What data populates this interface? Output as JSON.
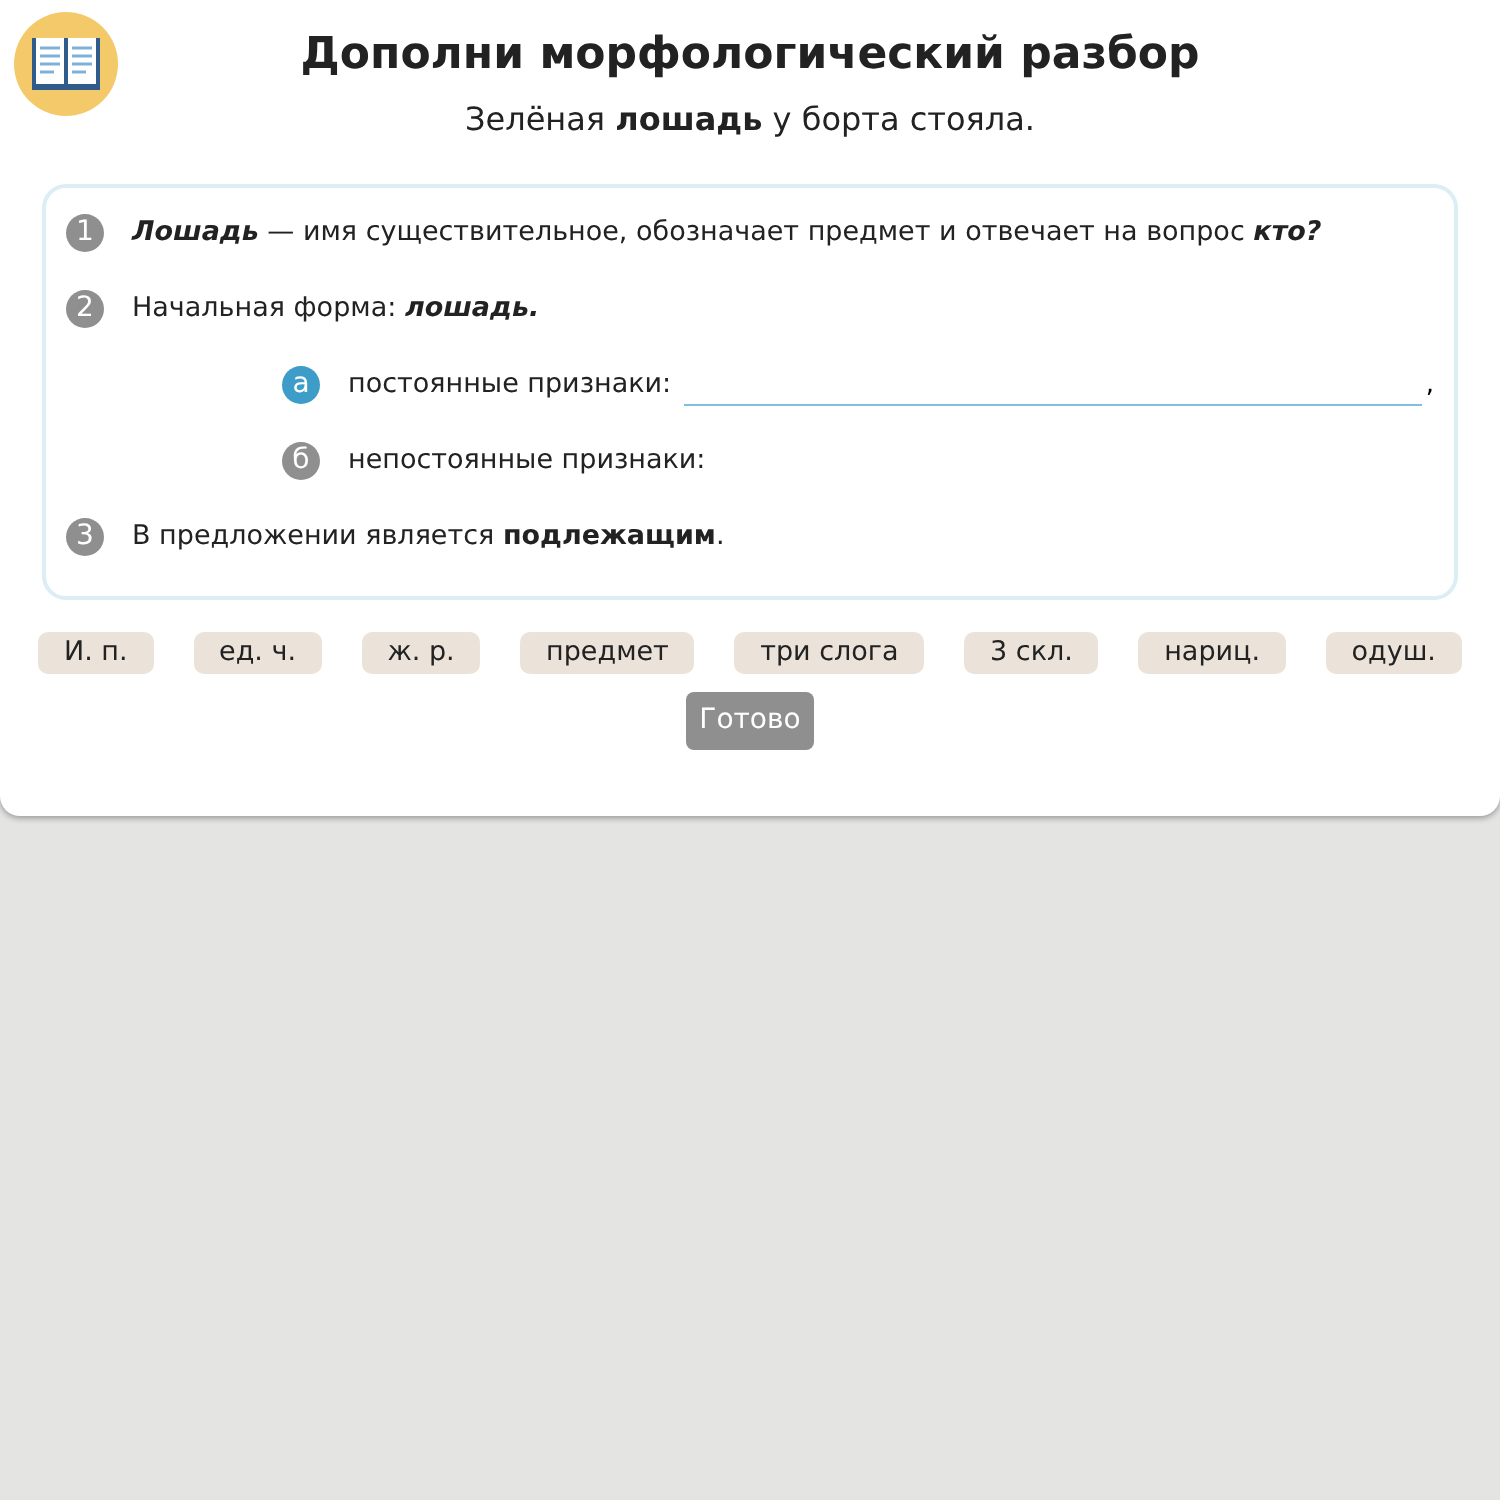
{
  "title": "Дополни морфологический разбор",
  "sentence": "Зелёная **лошадь** у борта стояла.",
  "items": [
    {
      "kind": "main",
      "marker": "1",
      "text": "*Лошадь* — имя существительное, обозначает предмет и отвечает на вопрос *кто?*"
    },
    {
      "kind": "main",
      "marker": "2",
      "text": "Начальная форма: *лошадь.*"
    },
    {
      "kind": "sub",
      "marker": "а",
      "text": "постоянные признаки:",
      "selected": true,
      "field": true,
      "after": ","
    },
    {
      "kind": "sub",
      "marker": "б",
      "text": "непостоянные признаки:",
      "selected": false,
      "field": false
    },
    {
      "kind": "main",
      "marker": "3",
      "text": "В предложении является **подлежащим**."
    }
  ],
  "chips": [
    "И. п.",
    "ед. ч.",
    "ж. р.",
    "предмет",
    "три слога",
    "3 скл.",
    "нариц.",
    "одуш."
  ],
  "done_button": {
    "label": "Готово",
    "disabled": true
  }
}
